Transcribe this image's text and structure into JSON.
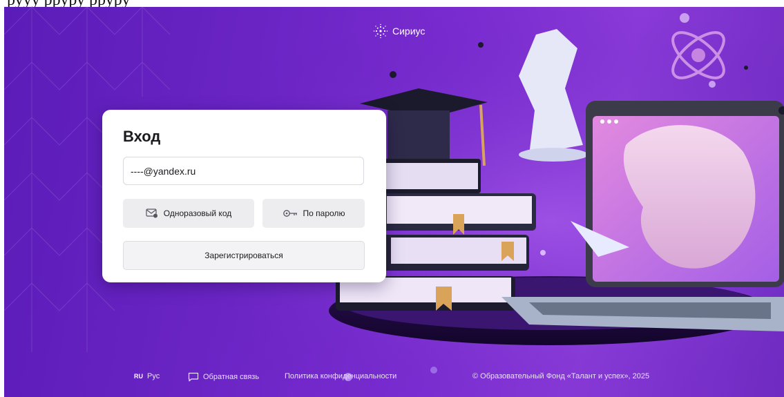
{
  "page_caption": "рууу рруру рруру",
  "brand": {
    "name": "Сириус"
  },
  "login": {
    "title": "Вход",
    "email_value": "----@yandex.ru",
    "otp_button": "Одноразовый код",
    "password_button": "По паролю",
    "register_button": "Зарегистрироваться"
  },
  "footer": {
    "lang_code": "RU",
    "lang_name": "Рус",
    "feedback": "Обратная связь",
    "privacy": "Политика конфиденциальности",
    "copyright": "© Образовательный Фонд «Талант и успех», 2025"
  },
  "colors": {
    "bg_primary": "#6a24c4",
    "card": "#ffffff",
    "button": "#ededf0"
  },
  "icons": [
    "sirius-logo-icon",
    "mail-icon",
    "key-icon",
    "chat-icon"
  ]
}
